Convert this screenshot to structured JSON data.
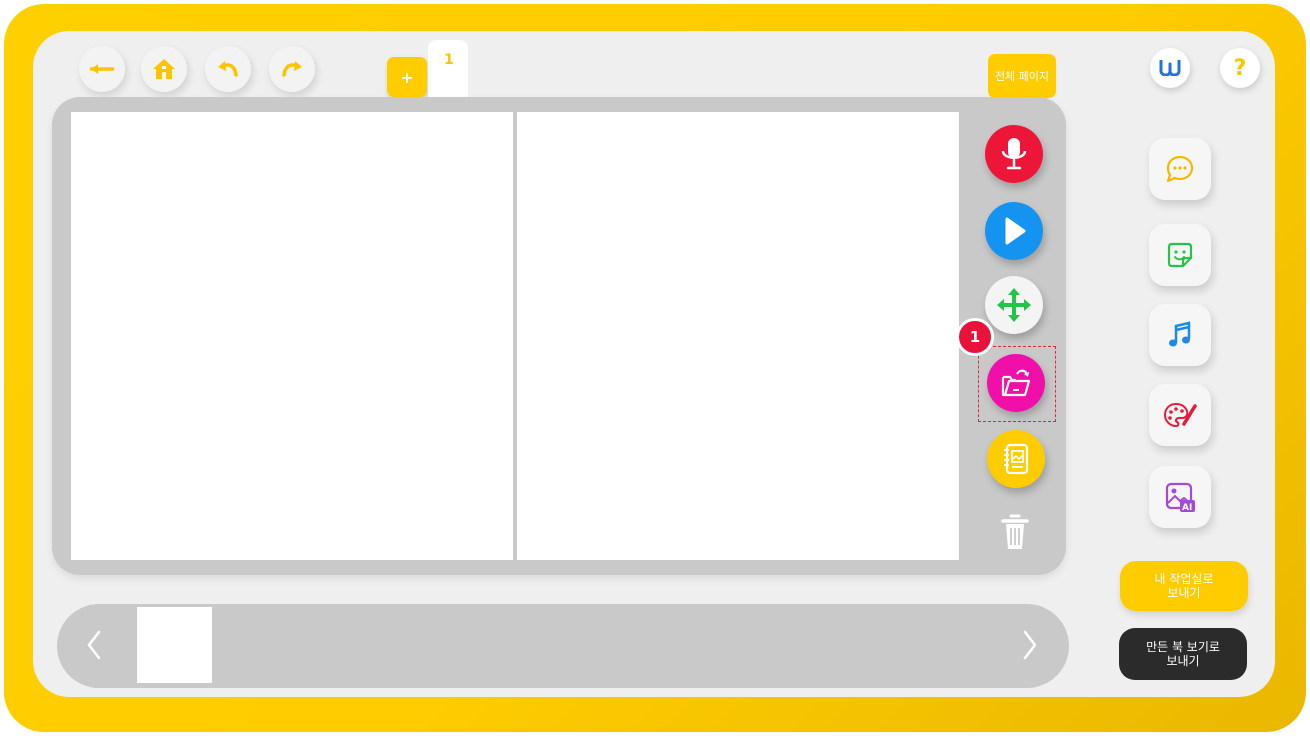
{
  "header": {
    "back_icon": "arrow-left-icon",
    "home_icon": "home-icon",
    "undo_icon": "undo-icon",
    "redo_icon": "redo-icon",
    "add_page_label": "+",
    "current_page_tab": "1",
    "all_pages_label": "전체 페이지",
    "brand_logo_text": "W",
    "help_label": "?"
  },
  "canvas_tools": [
    {
      "icon": "microphone-icon",
      "color": "#ee1638"
    },
    {
      "icon": "play-icon",
      "color": "#1593f0"
    },
    {
      "icon": "move-icon",
      "color": "#22c44a"
    },
    {
      "icon": "open-folder-icon",
      "color": "#f10faa"
    },
    {
      "icon": "album-icon",
      "color": "#ffcc00"
    },
    {
      "icon": "trash-icon",
      "color": "#ffffff"
    }
  ],
  "callout_number": "1",
  "side_tools": [
    {
      "icon": "speech-bubble-icon",
      "color": "#f5b800"
    },
    {
      "icon": "sticker-icon",
      "color": "#28c24a"
    },
    {
      "icon": "music-note-icon",
      "color": "#1e88e5"
    },
    {
      "icon": "palette-icon",
      "color": "#e8193c"
    },
    {
      "icon": "ai-image-icon",
      "color": "#a24bd9"
    }
  ],
  "actions": {
    "send_to_studio": "내 작업실로\n보내기",
    "send_to_book_view": "만든 북 보기로\n보내기"
  },
  "filmstrip": {
    "prev_icon": "chevron-left-icon",
    "next_icon": "chevron-right-icon",
    "thumbnail_count": 1
  },
  "colors": {
    "brand_yellow": "#ffcc00",
    "dark_button": "#2b2b2b"
  }
}
